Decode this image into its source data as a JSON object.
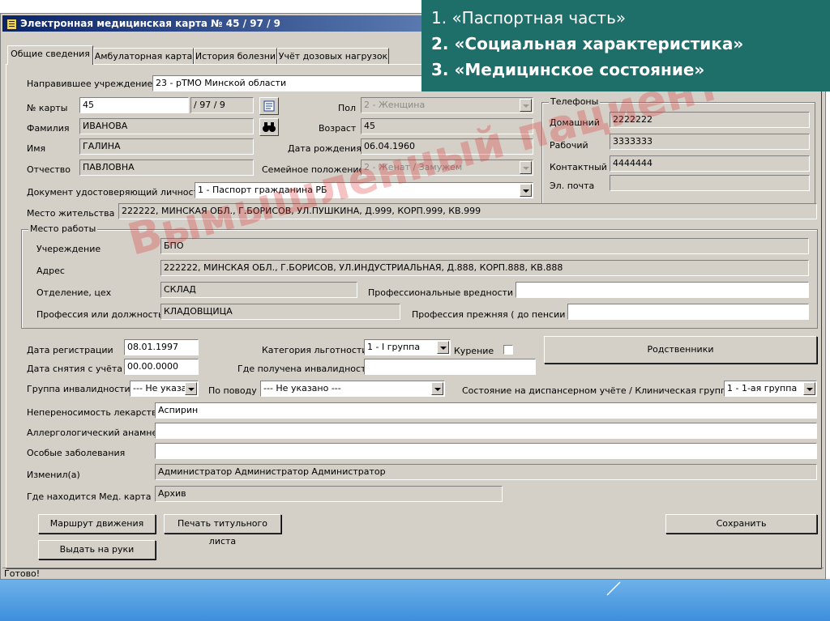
{
  "window": {
    "title": "Электронная медицинская карта № 45 / 97 / 9",
    "status": "Готово!"
  },
  "tabs": [
    "Общие сведения",
    "Амбулаторная карта",
    "История болезни",
    "Учёт дозовых нагрузок"
  ],
  "overlay": {
    "line1": "1. «Паспортная часть»",
    "line2": "2. «Социальная характеристика»",
    "line3": "3. «Медицинское состояние»"
  },
  "watermark": "Вымышленный пациент",
  "form": {
    "referring_label": "Направившее учреждение",
    "referring_value": "23 - рТМО Минской области",
    "card_no_label": "№ карты",
    "card_no_value": "45",
    "card_no_suffix": "/ 97 / 9",
    "surname_label": "Фамилия",
    "surname_value": "ИВАНОВА",
    "name_label": "Имя",
    "name_value": "ГАЛИНА",
    "patronymic_label": "Отчество",
    "patronymic_value": "ПАВЛОВНА",
    "sex_label": "Пол",
    "sex_value": "2 - Женщина",
    "age_label": "Возраст",
    "age_value": "45",
    "dob_label": "Дата рождения",
    "dob_value": "06.04.1960",
    "marital_label": "Семейное положение",
    "marital_value": "2 - Женат / Замужем",
    "id_doc_label": "Документ удостоверяющий личность",
    "id_doc_value": "1 - Паспорт гражданина РБ",
    "residence_label": "Место жительства",
    "residence_value": "222222, МИНСКАЯ ОБЛ., Г.БОРИСОВ, УЛ.ПУШКИНА, Д.999, КОРП.999, КВ.999"
  },
  "phones": {
    "group_title": "Телефоны",
    "home_label": "Домашний",
    "home_value": "2222222",
    "work_label": "Рабочий",
    "work_value": "3333333",
    "contact_label": "Контактный",
    "contact_value": "4444444",
    "email_label": "Эл. почта",
    "email_value": ""
  },
  "work": {
    "group_title": "Место работы",
    "org_label": "Учереждение",
    "org_value": "БПО",
    "address_label": "Адрес",
    "address_value": "222222, МИНСКАЯ ОБЛ., Г.БОРИСОВ, УЛ.ИНДУСТРИАЛЬНАЯ, Д.888, КОРП.888, КВ.888",
    "dept_label": "Отделение, цех",
    "dept_value": "СКЛАД",
    "hazards_label": "Профессиональные вредности",
    "hazards_value": "",
    "position_label": "Профессия или должность",
    "position_value": "КЛАДОВЩИЦА",
    "prev_prof_label": "Профессия прежняя ( до пенсии )",
    "prev_prof_value": ""
  },
  "registration": {
    "reg_date_label": "Дата регистрации",
    "reg_date_value": "08.01.1997",
    "dereg_date_label": "Дата снятия с учёта",
    "dereg_date_value": "00.00.0000",
    "benefit_label": "Категория льготности",
    "benefit_value": "1 - I группа",
    "smoking_label": "Курение",
    "disability_place_label": "Где получена инвалидность",
    "disability_place_value": "",
    "relatives_button": "Родственники",
    "disability_group_label": "Группа инвалидности",
    "disability_group_value": "--- Не указа",
    "reason_label": "По поводу",
    "reason_value": "--- Не указано ---",
    "dispensary_label": "Состояние на диспансерном учёте / Клиническая группа",
    "dispensary_value": "1 - 1-ая группа"
  },
  "medical": {
    "intolerance_label": "Непереносимость лекарств",
    "intolerance_value": "Аспирин",
    "allergy_label": "Аллергологический анамнез",
    "allergy_value": "",
    "special_label": "Особые заболевания",
    "special_value": "",
    "changed_by_label": "Изменил(а)",
    "changed_by_value": "Администратор Администратор Администратор",
    "card_location_label": "Где находится Мед. карта",
    "card_location_value": "Архив"
  },
  "buttons": {
    "route": "Маршрут движения",
    "print_title": "Печать титульного листа",
    "save": "Сохранить",
    "give_out": "Выдать на руки"
  },
  "colors": {
    "window_bg": "#d4d0c8",
    "title_start": "#0a246a",
    "title_end": "#a6caf0",
    "overlay_bg": "#1e6e6a",
    "watermark": "#dc2828"
  }
}
